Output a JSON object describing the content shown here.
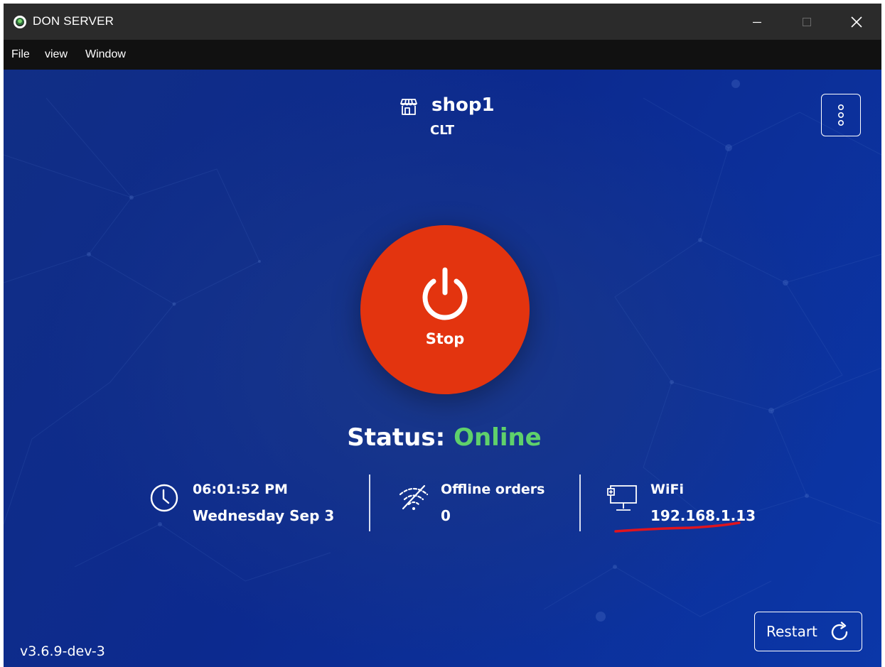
{
  "window": {
    "title": "DON SERVER",
    "app_icon": "don-server-logo",
    "controls": [
      "minimize-icon",
      "maximize-icon",
      "close-icon"
    ]
  },
  "menu": {
    "items": [
      {
        "label": "File"
      },
      {
        "label": "view"
      },
      {
        "label": "Window"
      }
    ]
  },
  "shop": {
    "icon": "store-icon",
    "name": "shop1",
    "code": "CLT"
  },
  "header": {
    "more_icon": "more-vertical-icon"
  },
  "power": {
    "icon": "power-icon",
    "label": "Stop",
    "color": "#e3340f"
  },
  "status": {
    "prefix": "Status:",
    "value": "Online",
    "value_color": "#5fd16b"
  },
  "info": {
    "clock": {
      "icon": "clock-icon",
      "time": "06:01:52 PM",
      "date": "Wednesday Sep 3"
    },
    "offline": {
      "icon": "wifi-off-icon",
      "label": "Offline orders",
      "count": "0"
    },
    "network": {
      "icon": "network-computer-icon",
      "type": "WiFi",
      "ip": "192.168.1.13"
    }
  },
  "footer": {
    "version": "v3.6.9-dev-3",
    "restart_label": "Restart",
    "restart_icon": "refresh-icon"
  },
  "colors": {
    "background": "#0c2a8f",
    "titlebar": "#2b2b2b",
    "menubar": "#111111",
    "annotation": "#e0141e"
  }
}
